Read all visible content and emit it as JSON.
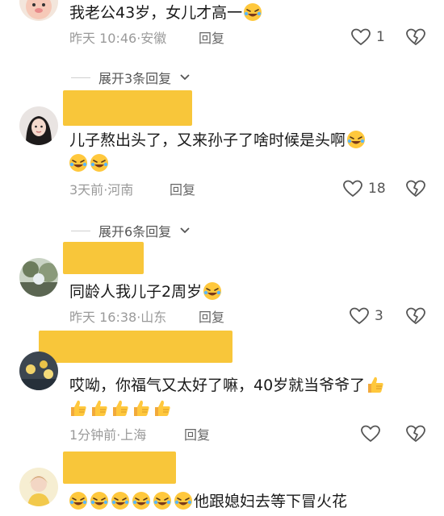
{
  "comments": [
    {
      "text": "我老公43岁，女儿才高一",
      "time": "昨天 10:46",
      "location": "安徽",
      "reply_label": "回复",
      "likes": "1"
    },
    {
      "text": "儿子熬出头了，又来孙子了啥时候是头啊",
      "time": "3天前",
      "location": "河南",
      "reply_label": "回复",
      "likes": "18"
    },
    {
      "text": "同龄人我儿子2周岁",
      "time": "昨天 16:38",
      "location": "山东",
      "reply_label": "回复",
      "likes": "3"
    },
    {
      "text": "哎呦，你福气又太好了嘛，40岁就当爷爷了",
      "time": "1分钟前",
      "location": "上海",
      "reply_label": "回复",
      "likes": ""
    },
    {
      "text": "他跟媳妇去等下冒火花"
    }
  ],
  "expand_replies": [
    {
      "label": "展开3条回复"
    },
    {
      "label": "展开6条回复"
    }
  ],
  "meta_separator": "·",
  "icons": {
    "like": "heart-outline-icon",
    "dislike": "broken-heart-icon",
    "expand": "chevron-down-icon",
    "laugh": "rofl-emoji",
    "thumbs": "thumbs-up-emoji"
  },
  "colors": {
    "redaction": "#f8c63a",
    "meta_text": "#9a9a9a",
    "emoji_face": "#ffc83d"
  }
}
